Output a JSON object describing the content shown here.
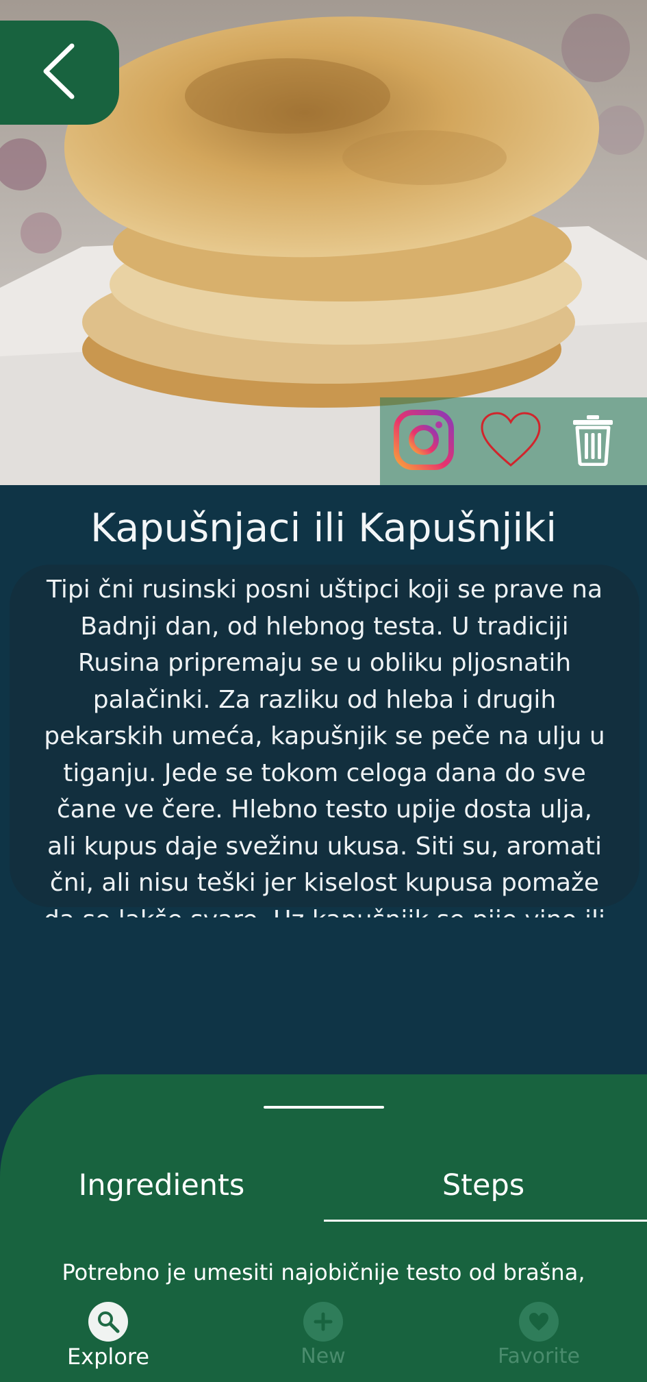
{
  "recipe": {
    "title": "Kapušnjaci ili Kapušnjiki",
    "description": "Tipi čni rusinski posni uštipci koji se prave na Badnji dan, od hlebnog testa. U tradiciji Rusina pripremaju se u obliku pljosnatih palačinki. Za razliku od hleba i drugih pekarskih umeća, kapušnjik se peče na ulju u tiganju. Jede se tokom celoga dana do sve čane ve čere. Hlebno testo upije dosta ulja, ali kupus daje svežinu ukusa. Siti su, aromati čni, ali nisu teški jer kiselost kupusa pomaže da se lakše svare. Uz kapušnjik se pije vino ili rakija. Napomena: kod"
  },
  "tabs": [
    {
      "label": "Ingredients",
      "active": false
    },
    {
      "label": "Steps",
      "active": true
    }
  ],
  "steps": {
    "first_line": "Potrebno je umesiti najobičnije testo od brašna,"
  },
  "nav": [
    {
      "label": "Explore",
      "icon": "search-icon",
      "active": true
    },
    {
      "label": "New",
      "icon": "plus-icon",
      "active": false
    },
    {
      "label": "Favorite",
      "icon": "heart-icon",
      "active": false
    }
  ],
  "actions": {
    "instagram": "instagram-icon",
    "favorite": "heart-outline-icon",
    "delete": "trash-icon"
  },
  "colors": {
    "background": "#0f3446",
    "sheet": "#18633f",
    "back_button": "#18633f",
    "heart": "#d1252c"
  }
}
